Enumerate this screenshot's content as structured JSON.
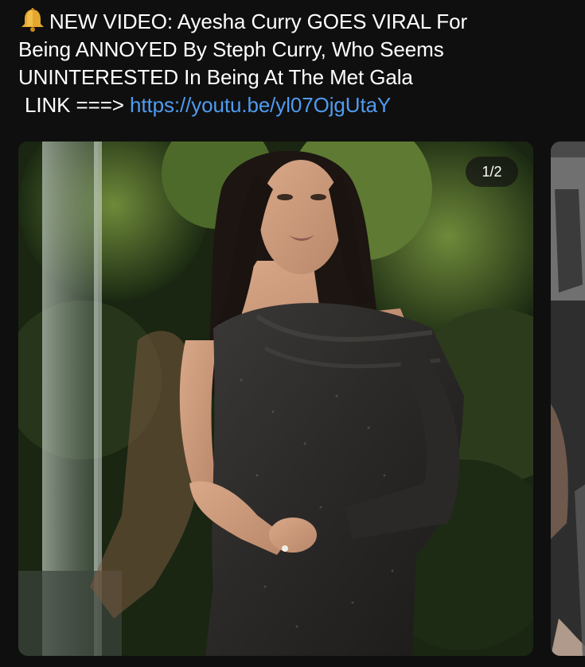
{
  "post": {
    "icon": "bell-icon",
    "line1": "NEW VIDEO: Ayesha Curry GOES VIRAL For",
    "line2": "Being ANNOYED By Steph Curry, Who Seems",
    "line3": "UNINTERESTED In Being At The Met Gala",
    "link_prefix": "LINK ===>",
    "link_url": "https://youtu.be/yl07OjgUtaY"
  },
  "carousel": {
    "counter": "1/2",
    "main_image_icon": "photo-woman-sparkly-dress",
    "next_image_icon": "photo-partial-next"
  },
  "colors": {
    "background": "#0f0f0f",
    "text": "#ffffff",
    "link": "#4f9cf0"
  }
}
